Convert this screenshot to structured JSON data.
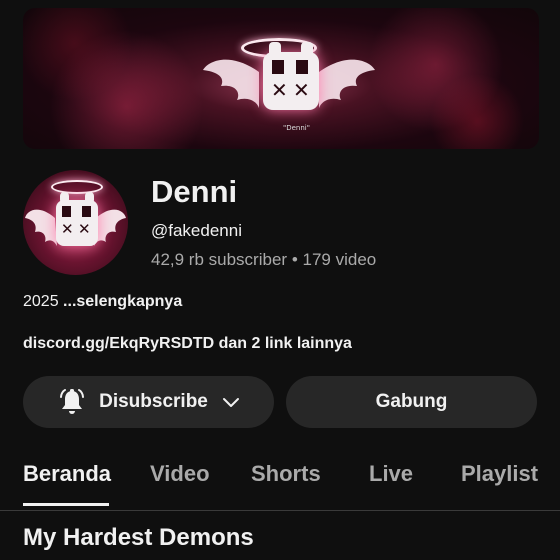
{
  "banner": {
    "tag": "\"Denni\""
  },
  "channel": {
    "name": "Denni",
    "handle": "@fakedenni",
    "subscribers": "42,9 rb subscriber",
    "separator": "•",
    "videos": "179 video"
  },
  "description": {
    "text": "2025 ",
    "more": "...selengkapnya"
  },
  "links": {
    "text": "discord.gg/EkqRyRSDTD dan 2 link lainnya"
  },
  "buttons": {
    "subscribe_label": "Disubscribe",
    "join_label": "Gabung"
  },
  "tabs": [
    {
      "label": "Beranda",
      "active": true
    },
    {
      "label": "Video"
    },
    {
      "label": "Shorts"
    },
    {
      "label": "Live"
    },
    {
      "label": "Playlist"
    }
  ],
  "section": {
    "title": "My Hardest Demons"
  },
  "colors": {
    "background": "#0f0f0f",
    "button_bg": "#272727",
    "text_primary": "#f1f1f1",
    "text_secondary": "#aaaaaa",
    "accent": "#c23a62"
  },
  "icons": {
    "bell": "bell-icon",
    "chevron": "chevron-down-icon"
  }
}
